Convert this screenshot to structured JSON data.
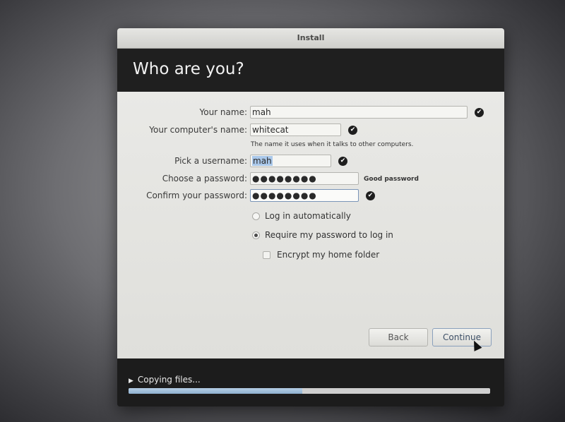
{
  "window": {
    "title": "Install"
  },
  "header": {
    "title": "Who are you?"
  },
  "form": {
    "name": {
      "label": "Your name:",
      "value": "mah"
    },
    "computer": {
      "label": "Your computer's name:",
      "value": "whitecat",
      "hint": "The name it uses when it talks to other computers."
    },
    "username": {
      "label": "Pick a username:",
      "value": "mah"
    },
    "password": {
      "label": "Choose a password:",
      "value": "●●●●●●●●",
      "strength": "Good password"
    },
    "confirm": {
      "label": "Confirm your password:",
      "value": "●●●●●●●●"
    },
    "login_auto": {
      "label": "Log in automatically",
      "selected": false
    },
    "login_password": {
      "label": "Require my password to log in",
      "selected": true
    },
    "encrypt": {
      "label": "Encrypt my home folder",
      "checked": false
    }
  },
  "buttons": {
    "back": "Back",
    "continue": "Continue"
  },
  "footer": {
    "status": "Copying files...",
    "progress": 0.48
  },
  "icons": {
    "valid": "checkmark-icon",
    "expand": "triangle-right-icon"
  }
}
